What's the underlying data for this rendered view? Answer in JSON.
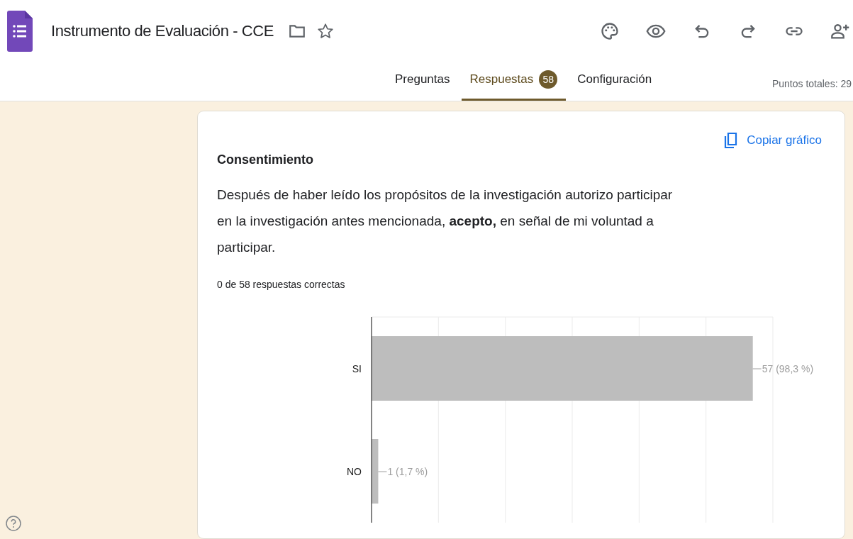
{
  "header": {
    "title": "Instrumento de Evaluación - CCE"
  },
  "tabs": [
    {
      "label": "Preguntas",
      "selected": false
    },
    {
      "label": "Respuestas",
      "selected": true,
      "badge": "58"
    },
    {
      "label": "Configuración",
      "selected": false
    }
  ],
  "total_points": "Puntos totales: 29",
  "question": {
    "title": "Consentimiento",
    "text": "Después de haber leído los propósitos de la investigación autorizo participar en la investigación antes mencionada, **acepto,** en señal de mi voluntad a participar.",
    "copy_label": "Copiar gráfico",
    "summary": "0 de 58 respuestas correctas",
    "chart_data": {
      "type": "bar",
      "orientation": "horizontal",
      "categories": [
        "SI",
        "NO"
      ],
      "values": [
        57,
        1
      ],
      "xlim": [
        0,
        60
      ],
      "data_labels": true,
      "value_labels": [
        "57 (98,3 %)",
        "1 (1,7 %)"
      ]
    }
  }
}
